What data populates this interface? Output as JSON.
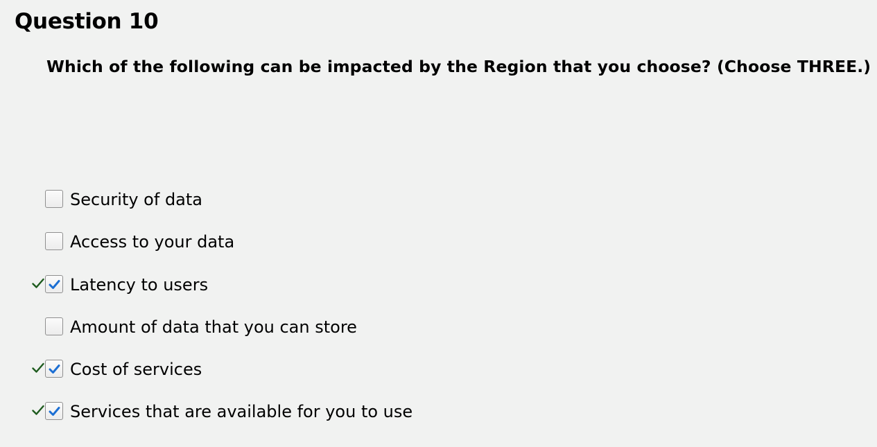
{
  "question": {
    "title": "Question 10",
    "text": "Which of the following can be impacted by the Region that you choose? (Choose THREE.)"
  },
  "options": [
    {
      "label": "Security of data",
      "checked": false,
      "correct": false
    },
    {
      "label": "Access to your data",
      "checked": false,
      "correct": false
    },
    {
      "label": "Latency to users",
      "checked": true,
      "correct": true
    },
    {
      "label": "Amount of data that you can store",
      "checked": false,
      "correct": false
    },
    {
      "label": "Cost of services",
      "checked": true,
      "correct": true
    },
    {
      "label": "Services that are available for you to use",
      "checked": true,
      "correct": true
    }
  ],
  "colors": {
    "background": "#f1f2f1",
    "checkmark_blue": "#1c6fd3",
    "correct_green": "#1e5b1e"
  },
  "icons": {
    "correct": "correct-checkmark-icon",
    "checkbox_tick": "checkbox-tick-icon"
  }
}
